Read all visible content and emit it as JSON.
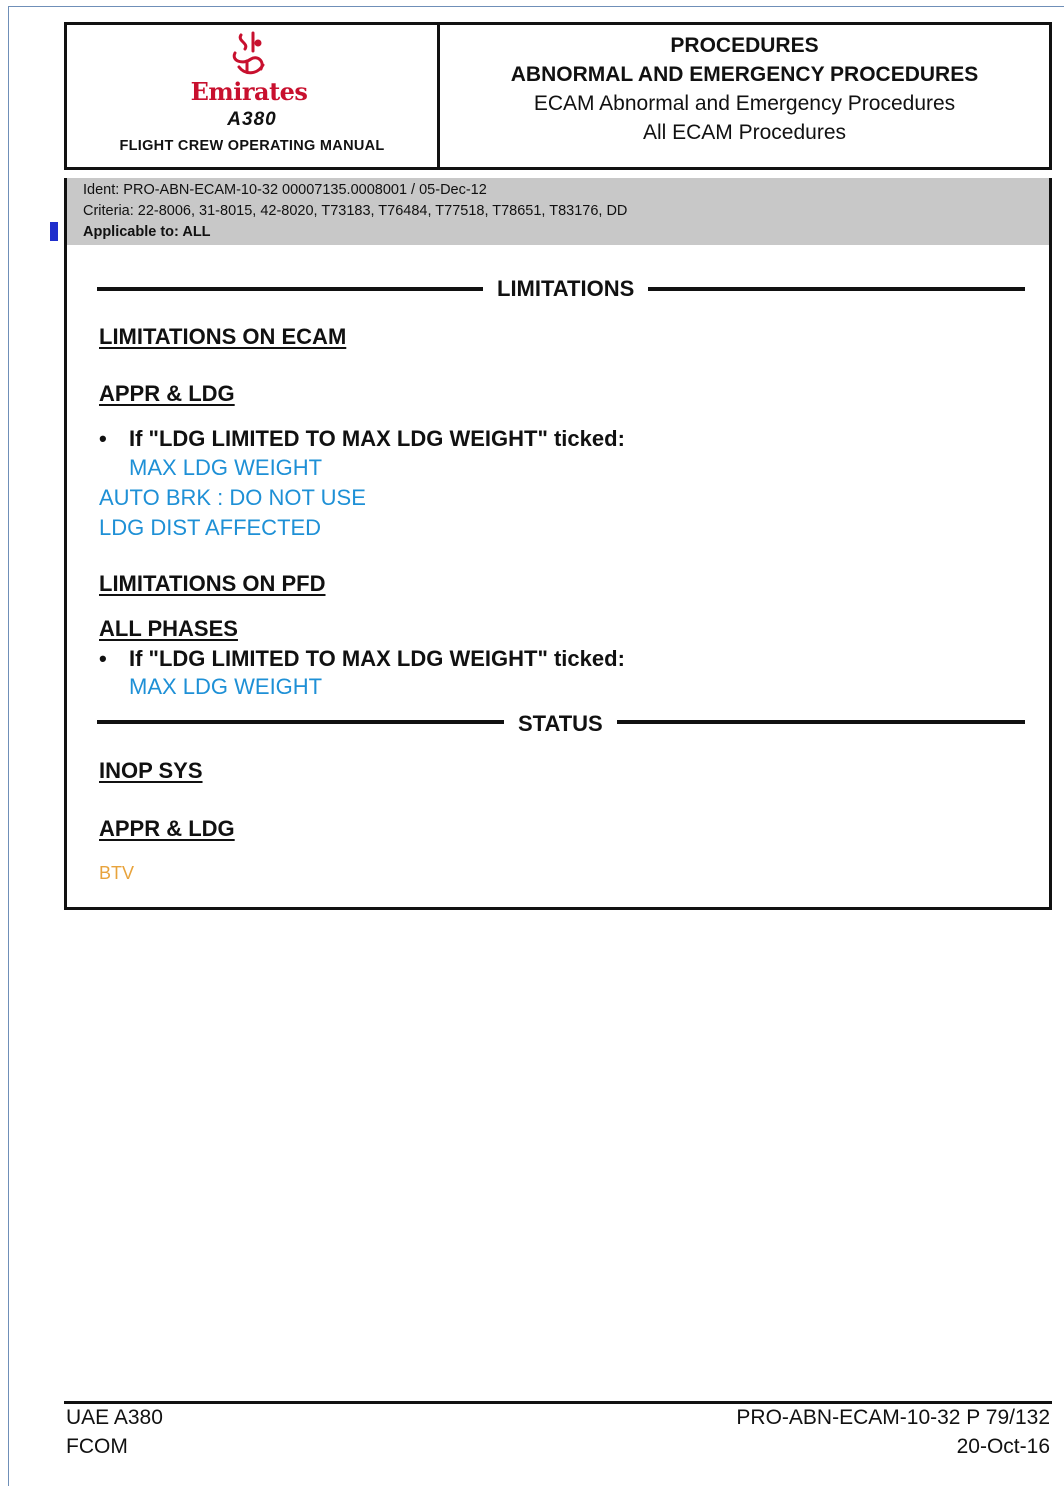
{
  "header": {
    "brand_name": "Emirates",
    "model": "A380",
    "manual_title": "FLIGHT CREW OPERATING MANUAL",
    "right_lines": [
      "PROCEDURES",
      "ABNORMAL AND EMERGENCY PROCEDURES",
      "ECAM Abnormal and Emergency Procedures",
      "All ECAM Procedures"
    ]
  },
  "ident": {
    "ident_line": "Ident: PRO-ABN-ECAM-10-32 00007135.0008001 / 05-Dec-12",
    "criteria_line": "Criteria: 22-8006, 31-8015, 42-8020, T73183, T76484, T77518, T78651, T83176, DD",
    "applicable_line": "Applicable to: ALL"
  },
  "limitations": {
    "title": "LIMITATIONS",
    "ecam_heading": "LIMITATIONS ON ECAM",
    "appr_ldg_heading": "APPR & LDG",
    "bullet_symbol": "•",
    "condition_1": "If \"LDG LIMITED TO MAX LDG WEIGHT\" ticked:",
    "max_ldg_weight_1": "MAX LDG WEIGHT",
    "auto_brk": "AUTO BRK : DO NOT USE",
    "ldg_dist": "LDG DIST AFFECTED",
    "pfd_heading": "LIMITATIONS ON PFD",
    "all_phases_heading": "ALL PHASES",
    "condition_2": "If \"LDG LIMITED TO MAX LDG WEIGHT\" ticked:",
    "max_ldg_weight_2": "MAX LDG WEIGHT"
  },
  "status": {
    "title": "STATUS",
    "inop_heading": "INOP SYS",
    "appr_ldg_heading": "APPR & LDG",
    "btv": "BTV"
  },
  "footer": {
    "left_line_1": "UAE A380",
    "left_line_2": "FCOM",
    "right_line_1": "PRO-ABN-ECAM-10-32 P 79/132",
    "right_line_2": "20-Oct-16"
  },
  "colors": {
    "ecam_blue": "#1e90d6",
    "ecam_amber": "#e8a33c",
    "brand_red": "#c8102e",
    "change_bar": "#1f2ecc"
  }
}
